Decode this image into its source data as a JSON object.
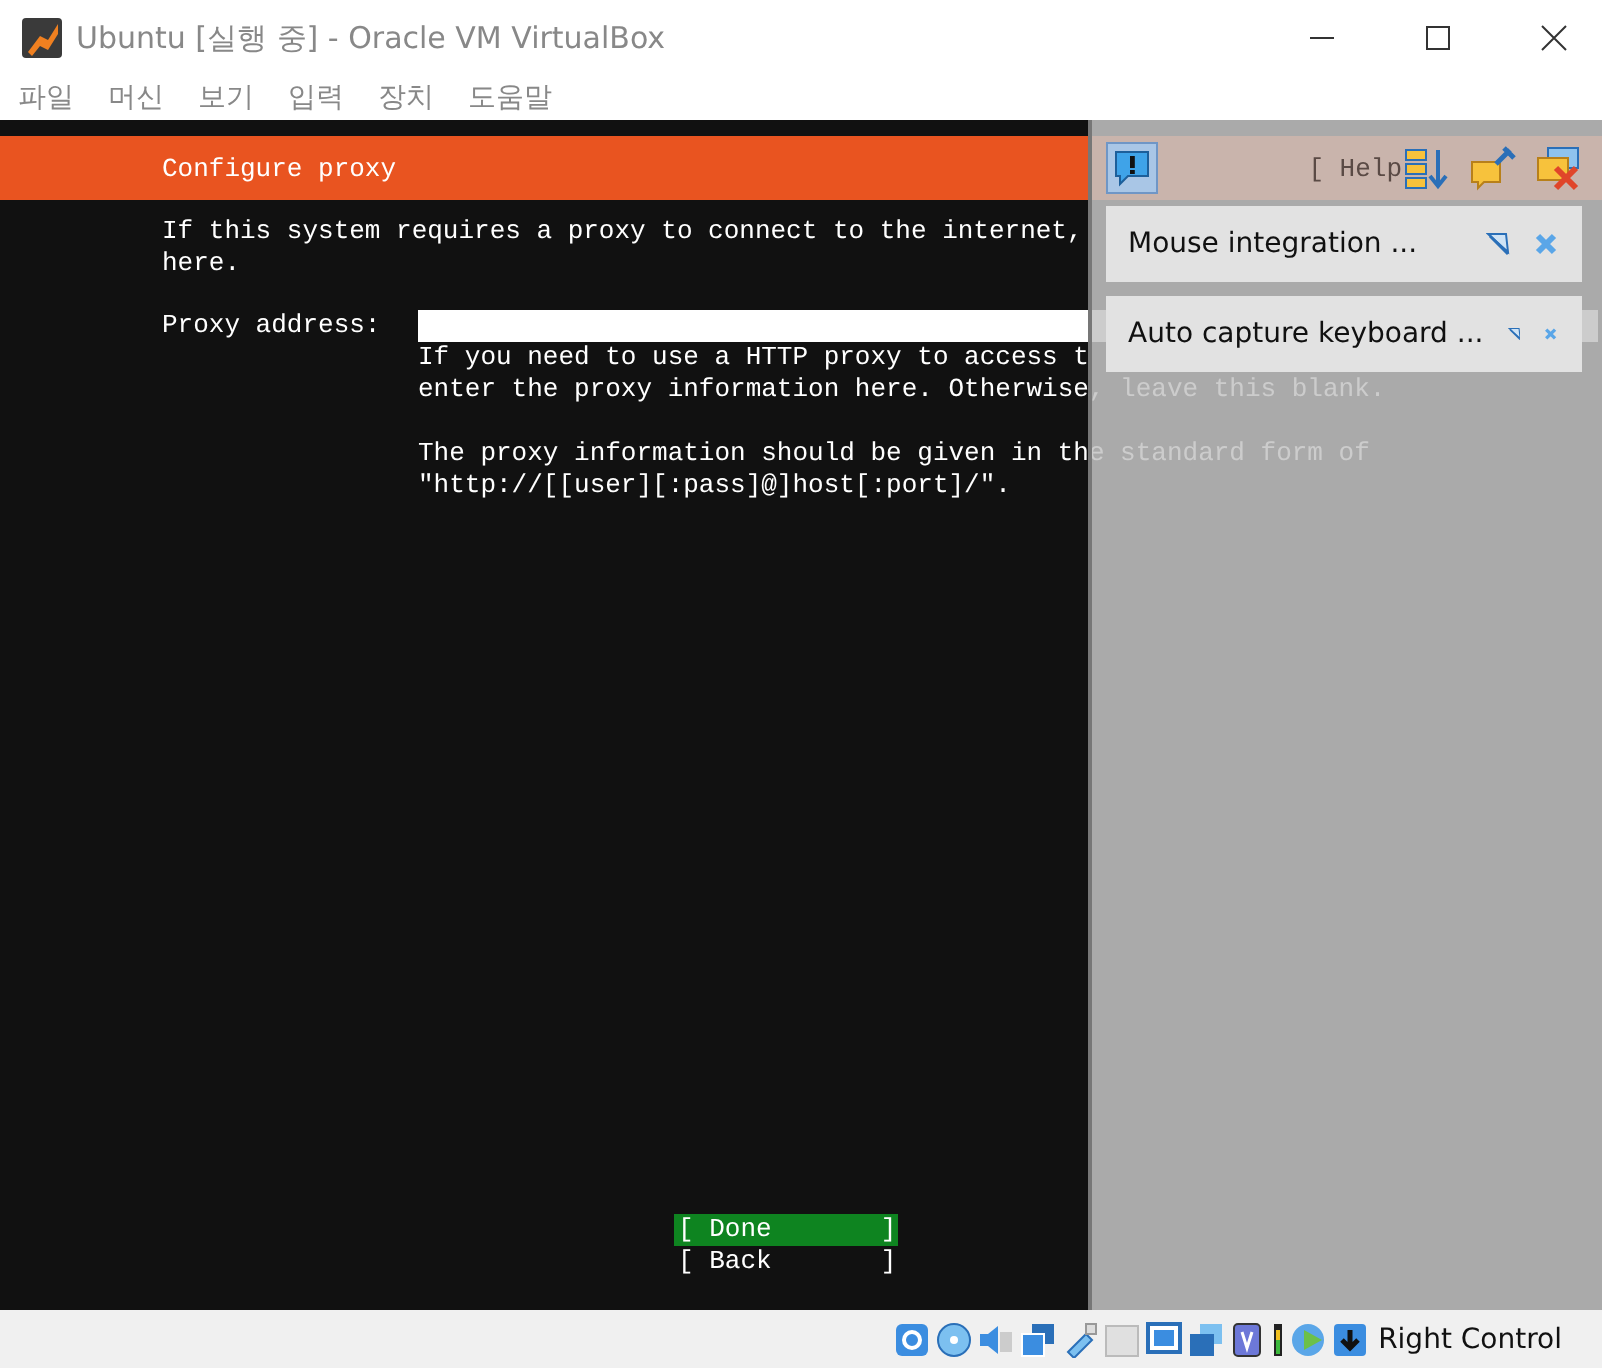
{
  "window": {
    "title": "Ubuntu [실행 중] - Oracle VM VirtualBox"
  },
  "menu": [
    "파일",
    "머신",
    "보기",
    "입력",
    "장치",
    "도움말"
  ],
  "installer": {
    "header": "Configure proxy",
    "help": "[ Help",
    "intro": [
      "If this system requires a proxy to connect to the internet,",
      "here."
    ],
    "field": {
      "label": "Proxy address:"
    },
    "hint": [
      [
        "If you need to use a HTTP proxy to access t",
        "enter the proxy information here. Otherwise, leave this blank."
      ],
      [
        "The proxy information should be given in the standard form of",
        "\"http://[[user][:pass]@]host[:port]/\"."
      ]
    ],
    "buttons": [
      {
        "label": "[ Done       ]",
        "selected": true
      },
      {
        "label": "[ Back       ]",
        "selected": false
      }
    ]
  },
  "notifications": [
    {
      "text": "Mouse integration ..."
    },
    {
      "text": "Auto capture keyboard ..."
    }
  ],
  "status_bar": {
    "host_key": "Right Control"
  }
}
